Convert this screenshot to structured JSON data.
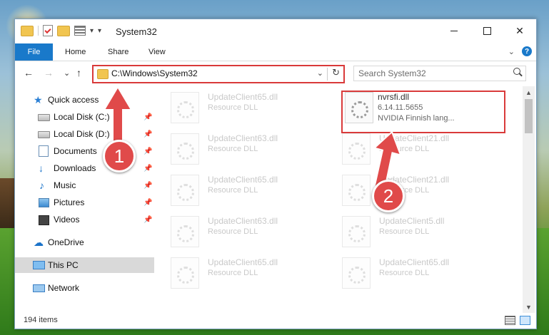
{
  "window": {
    "title": "System32",
    "qat_dropdown": "▾",
    "controls": {
      "minimize": "",
      "maximize": "",
      "close": "✕"
    }
  },
  "ribbon": {
    "tabs": [
      "File",
      "Home",
      "Share",
      "View"
    ],
    "expand": "⌄",
    "help": "?"
  },
  "navigation": {
    "back": "←",
    "forward": "→",
    "recent": "⌄",
    "up": "↑",
    "address_path": "C:\\Windows\\System32",
    "address_dropdown": "⌄",
    "refresh": "↻",
    "search_placeholder": "Search System32"
  },
  "nav_pane": {
    "items": [
      {
        "label": "Quick access",
        "icon": "star-icon"
      },
      {
        "label": "Local Disk (C:)",
        "icon": "drive-icon",
        "pinned": true
      },
      {
        "label": "Local Disk (D:)",
        "icon": "drive-icon",
        "pinned": true
      },
      {
        "label": "Documents",
        "icon": "documents-icon",
        "pinned": true
      },
      {
        "label": "Downloads",
        "icon": "downloads-icon",
        "pinned": true
      },
      {
        "label": "Music",
        "icon": "music-icon",
        "pinned": true
      },
      {
        "label": "Pictures",
        "icon": "pictures-icon",
        "pinned": true
      },
      {
        "label": "Videos",
        "icon": "videos-icon",
        "pinned": true
      },
      {
        "label": "OneDrive",
        "icon": "onedrive-icon"
      },
      {
        "label": "This PC",
        "icon": "this-pc-icon",
        "selected": true
      },
      {
        "label": "Network",
        "icon": "network-icon"
      }
    ],
    "pin_glyph": "📌"
  },
  "files": {
    "focused": {
      "name": "nvrsfi.dll",
      "version": "6.14.11.5655",
      "description": "NVIDIA Finnish lang..."
    },
    "left_column": [
      {
        "name": "UpdateClient65.dll",
        "type": "Resource DLL"
      },
      {
        "name": "UpdateClient63.dll",
        "type": "Resource DLL"
      },
      {
        "name": "UpdateClient65.dll",
        "type": "Resource DLL"
      },
      {
        "name": "UpdateClient63.dll",
        "type": "Resource DLL"
      },
      {
        "name": "UpdateClient65.dll",
        "type": "Resource DLL"
      }
    ],
    "right_column": [
      {
        "name": "UpdateClient21.dll",
        "type": "Resource DLL"
      },
      {
        "name": "UpdateClient21.dll",
        "type": "Resource DLL"
      },
      {
        "name": "UpdateClient5.dll",
        "type": "Resource DLL"
      },
      {
        "name": "UpdateClient65.dll",
        "type": "Resource DLL"
      }
    ]
  },
  "scrollbar": {
    "up": "▲",
    "down": "▼"
  },
  "status": {
    "item_count": "194 items"
  },
  "annotations": {
    "badge1": "1",
    "badge2": "2"
  },
  "colors": {
    "accent": "#1979ca",
    "highlight": "#d93a3a",
    "selected": "#cce8ff"
  }
}
